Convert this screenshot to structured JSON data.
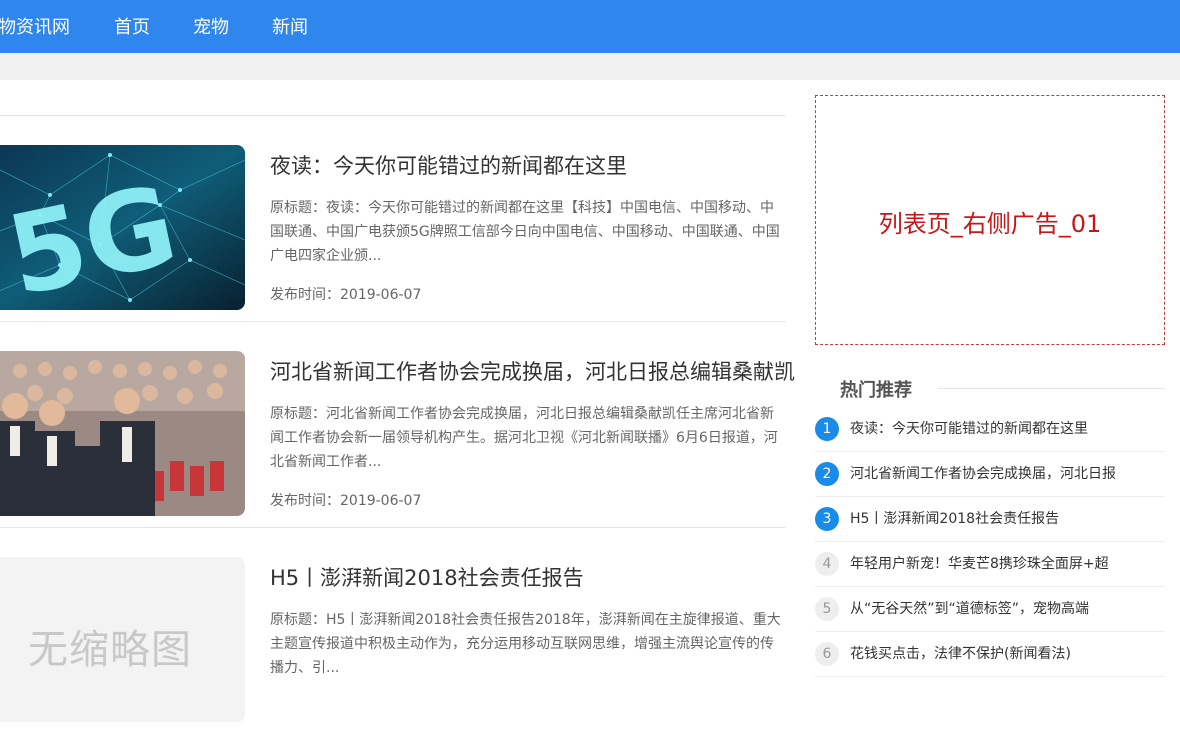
{
  "nav": {
    "brand": "物资讯网",
    "items": [
      "首页",
      "宠物",
      "新闻"
    ]
  },
  "articles": [
    {
      "title": "夜读：今天你可能错过的新闻都在这里",
      "summary": "原标题：夜读：今天你可能错过的新闻都在这里【科技】中国电信、中国移动、中国联通、中国广电获颁5G牌照工信部今日向中国电信、中国移动、中国联通、中国广电四家企业颁...",
      "date": "发布时间：2019-06-07",
      "thumb_text": "5G"
    },
    {
      "title": "河北省新闻工作者协会完成换届，河北日报总编辑桑献凯",
      "summary": "原标题：河北省新闻工作者协会完成换届，河北日报总编辑桑献凯任主席河北省新闻工作者协会新一届领导机构产生。据河北卫视《河北新闻联播》6月6日报道，河北省新闻工作者...",
      "date": "发布时间：2019-06-07"
    },
    {
      "title": "H5丨澎湃新闻2018社会责任报告",
      "summary": "原标题：H5丨澎湃新闻2018社会责任报告2018年，澎湃新闻在主旋律报道、重大主题宣传报道中积极主动作为，充分运用移动互联网思维，增强主流舆论宣传的传播力、引...",
      "thumb_text": "无缩略图"
    }
  ],
  "sidebar": {
    "ad_text": "列表页_右侧广告_01",
    "hot_title": "热门推荐",
    "hot_items": [
      {
        "num": "1",
        "text": "夜读：今天你可能错过的新闻都在这里"
      },
      {
        "num": "2",
        "text": "河北省新闻工作者协会完成换届，河北日报"
      },
      {
        "num": "3",
        "text": "H5丨澎湃新闻2018社会责任报告"
      },
      {
        "num": "4",
        "text": "年轻用户新宠！华麦芒8携珍珠全面屏+超"
      },
      {
        "num": "5",
        "text": "从“无谷天然”到“道德标签”，宠物高端"
      },
      {
        "num": "6",
        "text": "花钱买点击，法律不保护(新闻看法)"
      }
    ]
  },
  "colors": {
    "header": "#2f86ec",
    "rank_top": "#1a8be8",
    "ad_text": "#c61616"
  }
}
